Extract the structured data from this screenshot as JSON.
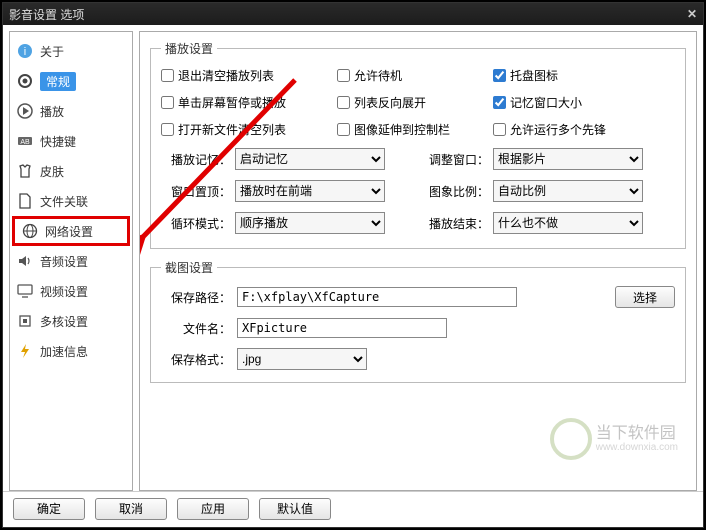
{
  "window": {
    "title": "影音设置 选项"
  },
  "sidebar": {
    "items": [
      {
        "id": "about",
        "label": "关于"
      },
      {
        "id": "general",
        "label": "常规"
      },
      {
        "id": "playback",
        "label": "播放"
      },
      {
        "id": "hotkey",
        "label": "快捷键"
      },
      {
        "id": "skin",
        "label": "皮肤"
      },
      {
        "id": "assoc",
        "label": "文件关联"
      },
      {
        "id": "network",
        "label": "网络设置"
      },
      {
        "id": "audio",
        "label": "音频设置"
      },
      {
        "id": "video",
        "label": "视频设置"
      },
      {
        "id": "multicore",
        "label": "多核设置"
      },
      {
        "id": "accel",
        "label": "加速信息"
      }
    ]
  },
  "play": {
    "legend": "播放设置",
    "cb": {
      "clear_on_exit": {
        "label": "退出清空播放列表",
        "checked": false
      },
      "allow_standby": {
        "label": "允许待机",
        "checked": false
      },
      "tray_icon": {
        "label": "托盘图标",
        "checked": true
      },
      "click_pause": {
        "label": "单击屏幕暂停或播放",
        "checked": false
      },
      "reverse_expand": {
        "label": "列表反向展开",
        "checked": false
      },
      "remember_size": {
        "label": "记忆窗口大小",
        "checked": true
      },
      "clear_on_new": {
        "label": "打开新文件清空列表",
        "checked": false
      },
      "image_to_ctrl": {
        "label": "图像延伸到控制栏",
        "checked": false
      },
      "allow_multiple": {
        "label": "允许运行多个先锋",
        "checked": false
      }
    },
    "dd": {
      "play_memory": {
        "label": "播放记忆：",
        "value": "启动记忆"
      },
      "adjust_window": {
        "label": "调整窗口：",
        "value": "根据影片"
      },
      "window_top": {
        "label": "窗口置顶：",
        "value": "播放时在前端"
      },
      "image_ratio": {
        "label": "图象比例：",
        "value": "自动比例"
      },
      "loop_mode": {
        "label": "循环模式：",
        "value": "顺序播放"
      },
      "play_end": {
        "label": "播放结束：",
        "value": "什么也不做"
      }
    }
  },
  "capture": {
    "legend": "截图设置",
    "path_label": "保存路径：",
    "path_value": "F:\\xfplay\\XfCapture",
    "browse": "选择",
    "name_label": "文件名：",
    "name_value": "XFpicture",
    "format_label": "保存格式：",
    "format_value": ".jpg"
  },
  "buttons": {
    "ok": "确定",
    "cancel": "取消",
    "apply": "应用",
    "default": "默认值"
  },
  "watermark": {
    "cn": "当下软件园",
    "en": "www.downxia.com"
  }
}
